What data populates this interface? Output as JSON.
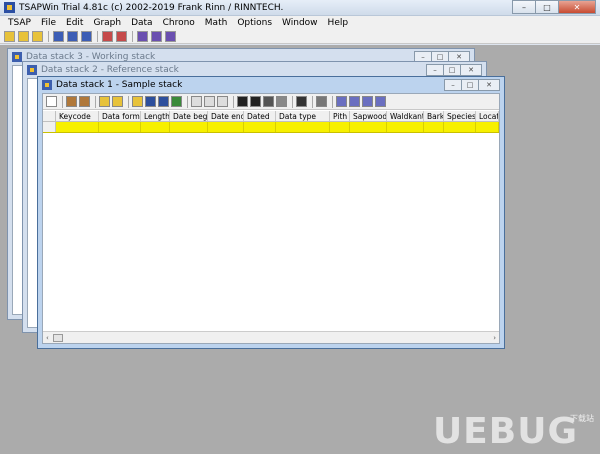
{
  "app": {
    "title": "TSAPWin Trial 4.81c  (c) 2002-2019 Frank Rinn / RINNTECH.",
    "controls": {
      "minimize": "–",
      "maximize": "□",
      "close": "✕"
    }
  },
  "menu": [
    "TSAP",
    "File",
    "Edit",
    "Graph",
    "Data",
    "Chrono",
    "Math",
    "Options",
    "Window",
    "Help"
  ],
  "windows": {
    "working": {
      "title": "Data stack 3 - Working stack"
    },
    "reference": {
      "title": "Data stack 2 - Reference stack"
    },
    "sample": {
      "title": "Data stack 1 - Sample stack",
      "columns": [
        "Keycode",
        "Data format",
        "Length",
        "Date begin",
        "Date end",
        "Dated",
        "Data type",
        "Pith",
        "Sapwood",
        "Waldkante",
        "Bark",
        "Species",
        "Locati"
      ],
      "scroll_left": "‹",
      "scroll_right": "›"
    }
  },
  "watermark": {
    "text": "UEBUG",
    "sub": "下载站"
  },
  "colors": {
    "selected_row": "#f7f000",
    "mdi_background": "#ababab",
    "active_title": "#bcd3ee"
  }
}
